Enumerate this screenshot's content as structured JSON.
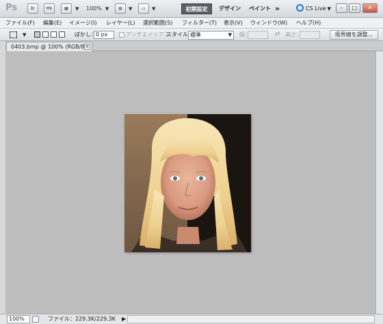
{
  "app": {
    "logo": "Ps",
    "launchers": [
      "Br",
      "Mb"
    ],
    "zoom_level": "100%",
    "workspaces": [
      "初期設定",
      "デザイン",
      "ペイント"
    ],
    "more": "»",
    "cs_live": "CS Live",
    "window_controls": [
      "–",
      "□",
      "✕"
    ]
  },
  "menu": [
    "ファイル(F)",
    "編集(E)",
    "イメージ(I)",
    "レイヤー(L)",
    "選択範囲(S)",
    "フィルター(T)",
    "表示(V)",
    "ウィンドウ(W)",
    "ヘルプ(H)"
  ],
  "options": {
    "feather_label": "ぼかし：",
    "feather_value": "0 px",
    "antialias_label": "アンチエイリアス",
    "style_label": "スタイル：",
    "style_value": "標準",
    "width_label": "幅：",
    "height_label": "高さ：",
    "refine_edge": "境界線を調整..."
  },
  "document": {
    "tab_title": "0403.bmp @ 100% (RGB/8)",
    "tab_close": "×"
  },
  "status": {
    "zoom": "100%",
    "file_info": "ファイル：229.3K/229.3K"
  },
  "colors": {
    "canvas_bg": "#bdbdbd",
    "active_workspace": "#5b5f66",
    "cs_live_accent": "#1f7ad1"
  }
}
